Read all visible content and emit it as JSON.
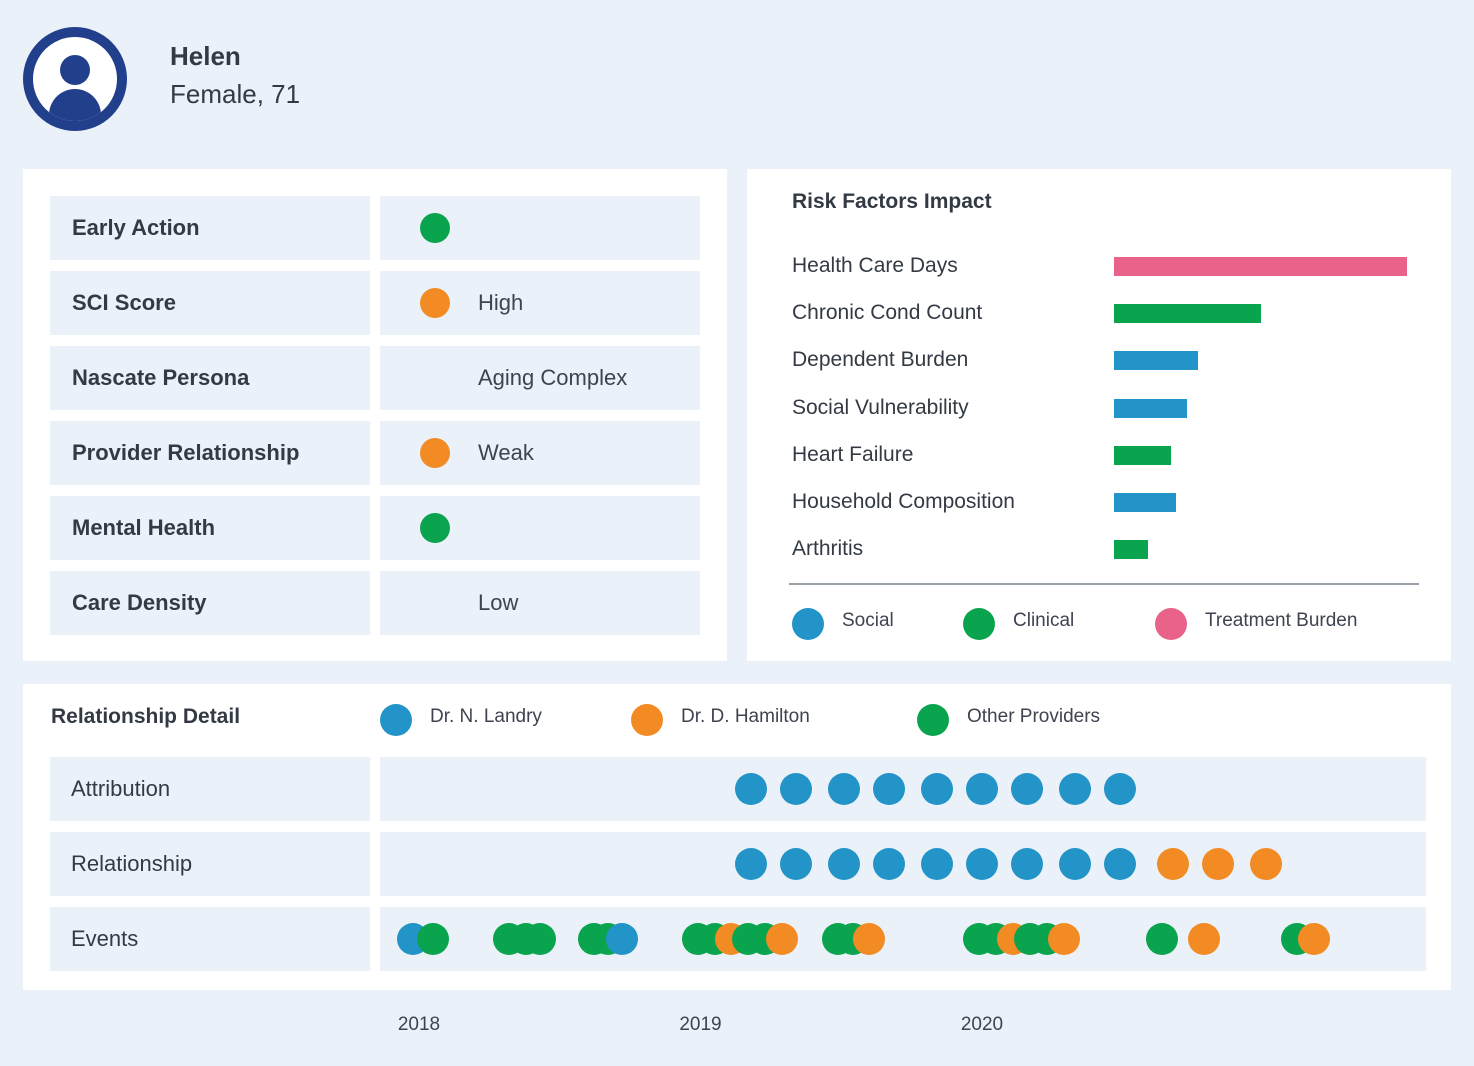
{
  "patient": {
    "name": "Helen",
    "demographics": "Female, 71"
  },
  "attributes": [
    {
      "label": "Early Action",
      "indicator": "#0ba44e",
      "value": ""
    },
    {
      "label": "SCI Score",
      "indicator": "#f28b23",
      "value": "High"
    },
    {
      "label": "Nascate Persona",
      "indicator": null,
      "value": "Aging Complex"
    },
    {
      "label": "Provider Relationship",
      "indicator": "#f28b23",
      "value": "Weak"
    },
    {
      "label": "Mental Health",
      "indicator": "#0ba44e",
      "value": ""
    },
    {
      "label": "Care Density",
      "indicator": null,
      "value": "Low"
    }
  ],
  "risk": {
    "title": "Risk Factors Impact",
    "factors": [
      {
        "label": "Health Care Days",
        "category": "Treatment Burden",
        "value": 1.0
      },
      {
        "label": "Chronic Cond Count",
        "category": "Clinical",
        "value": 0.5
      },
      {
        "label": "Dependent Burden",
        "category": "Social",
        "value": 0.285
      },
      {
        "label": "Social Vulnerability",
        "category": "Social",
        "value": 0.25
      },
      {
        "label": "Heart Failure",
        "category": "Clinical",
        "value": 0.195
      },
      {
        "label": "Household Composition",
        "category": "Social",
        "value": 0.21
      },
      {
        "label": "Arthritis",
        "category": "Clinical",
        "value": 0.115
      }
    ],
    "legend": [
      {
        "label": "Social",
        "color": "#2394c8"
      },
      {
        "label": "Clinical",
        "color": "#0ba44e"
      },
      {
        "label": "Treatment Burden",
        "color": "#e8628a"
      }
    ]
  },
  "relationship": {
    "title": "Relationship Detail",
    "legend": [
      {
        "label": "Dr. N. Landry",
        "color": "#2394c8"
      },
      {
        "label": "Dr. D. Hamilton",
        "color": "#f28b23"
      },
      {
        "label": "Other Providers",
        "color": "#0ba44e"
      }
    ],
    "rows": [
      {
        "label": "Attribution",
        "events": [
          {
            "t": 2019.18,
            "provider": "Dr. N. Landry"
          },
          {
            "t": 2019.34,
            "provider": "Dr. N. Landry"
          },
          {
            "t": 2019.51,
            "provider": "Dr. N. Landry"
          },
          {
            "t": 2019.67,
            "provider": "Dr. N. Landry"
          },
          {
            "t": 2019.84,
            "provider": "Dr. N. Landry"
          },
          {
            "t": 2020.0,
            "provider": "Dr. N. Landry"
          },
          {
            "t": 2020.16,
            "provider": "Dr. N. Landry"
          },
          {
            "t": 2020.33,
            "provider": "Dr. N. Landry"
          },
          {
            "t": 2020.49,
            "provider": "Dr. N. Landry"
          }
        ]
      },
      {
        "label": "Relationship",
        "events": [
          {
            "t": 2019.18,
            "provider": "Dr. N. Landry"
          },
          {
            "t": 2019.34,
            "provider": "Dr. N. Landry"
          },
          {
            "t": 2019.51,
            "provider": "Dr. N. Landry"
          },
          {
            "t": 2019.67,
            "provider": "Dr. N. Landry"
          },
          {
            "t": 2019.84,
            "provider": "Dr. N. Landry"
          },
          {
            "t": 2020.0,
            "provider": "Dr. N. Landry"
          },
          {
            "t": 2020.16,
            "provider": "Dr. N. Landry"
          },
          {
            "t": 2020.33,
            "provider": "Dr. N. Landry"
          },
          {
            "t": 2020.49,
            "provider": "Dr. N. Landry"
          },
          {
            "t": 2020.68,
            "provider": "Dr. D. Hamilton"
          },
          {
            "t": 2020.84,
            "provider": "Dr. D. Hamilton"
          },
          {
            "t": 2021.01,
            "provider": "Dr. D. Hamilton"
          }
        ]
      },
      {
        "label": "Events",
        "events": [
          {
            "t": 2017.98,
            "provider": "Dr. N. Landry"
          },
          {
            "t": 2018.05,
            "provider": "Other Providers"
          },
          {
            "t": 2018.32,
            "provider": "Other Providers"
          },
          {
            "t": 2018.38,
            "provider": "Other Providers"
          },
          {
            "t": 2018.43,
            "provider": "Other Providers"
          },
          {
            "t": 2018.62,
            "provider": "Other Providers"
          },
          {
            "t": 2018.67,
            "provider": "Other Providers"
          },
          {
            "t": 2018.72,
            "provider": "Dr. N. Landry"
          },
          {
            "t": 2018.99,
            "provider": "Other Providers"
          },
          {
            "t": 2019.05,
            "provider": "Other Providers"
          },
          {
            "t": 2019.11,
            "provider": "Dr. D. Hamilton"
          },
          {
            "t": 2019.17,
            "provider": "Other Providers"
          },
          {
            "t": 2019.23,
            "provider": "Other Providers"
          },
          {
            "t": 2019.29,
            "provider": "Dr. D. Hamilton"
          },
          {
            "t": 2019.49,
            "provider": "Other Providers"
          },
          {
            "t": 2019.54,
            "provider": "Other Providers"
          },
          {
            "t": 2019.6,
            "provider": "Dr. D. Hamilton"
          },
          {
            "t": 2019.99,
            "provider": "Other Providers"
          },
          {
            "t": 2020.05,
            "provider": "Other Providers"
          },
          {
            "t": 2020.11,
            "provider": "Dr. D. Hamilton"
          },
          {
            "t": 2020.17,
            "provider": "Other Providers"
          },
          {
            "t": 2020.23,
            "provider": "Other Providers"
          },
          {
            "t": 2020.29,
            "provider": "Dr. D. Hamilton"
          },
          {
            "t": 2020.64,
            "provider": "Other Providers"
          },
          {
            "t": 2020.79,
            "provider": "Dr. D. Hamilton"
          },
          {
            "t": 2021.12,
            "provider": "Other Providers"
          },
          {
            "t": 2021.18,
            "provider": "Dr. D. Hamilton"
          }
        ]
      }
    ],
    "years": [
      "2018",
      "2019",
      "2020"
    ]
  }
}
